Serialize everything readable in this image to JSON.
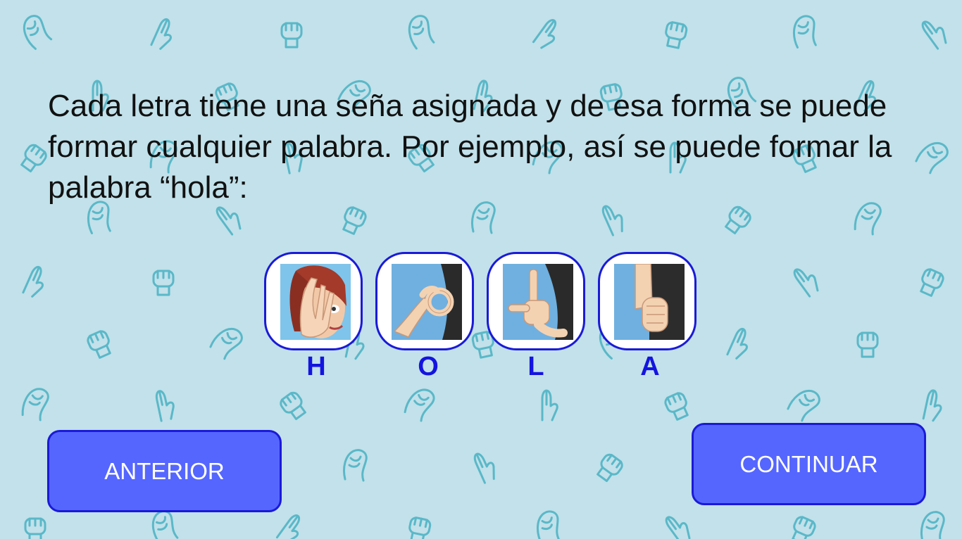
{
  "intro": {
    "text": "Cada letra tiene una seña asignada y de esa forma se puede formar cualquier palabra. Por ejemplo, así se puede formar la palabra “hola”:"
  },
  "signs": [
    {
      "letter": "H",
      "icon": "sign-h-icon"
    },
    {
      "letter": "O",
      "icon": "sign-o-icon"
    },
    {
      "letter": "L",
      "icon": "sign-l-icon"
    },
    {
      "letter": "A",
      "icon": "sign-a-icon"
    }
  ],
  "navigation": {
    "prev_label": "ANTERIOR",
    "next_label": "CONTINUAR"
  },
  "colors": {
    "background": "#c2e1ea",
    "pattern": "#5ab8c8",
    "accent": "#1a1ad8",
    "button": "#5566ff"
  }
}
